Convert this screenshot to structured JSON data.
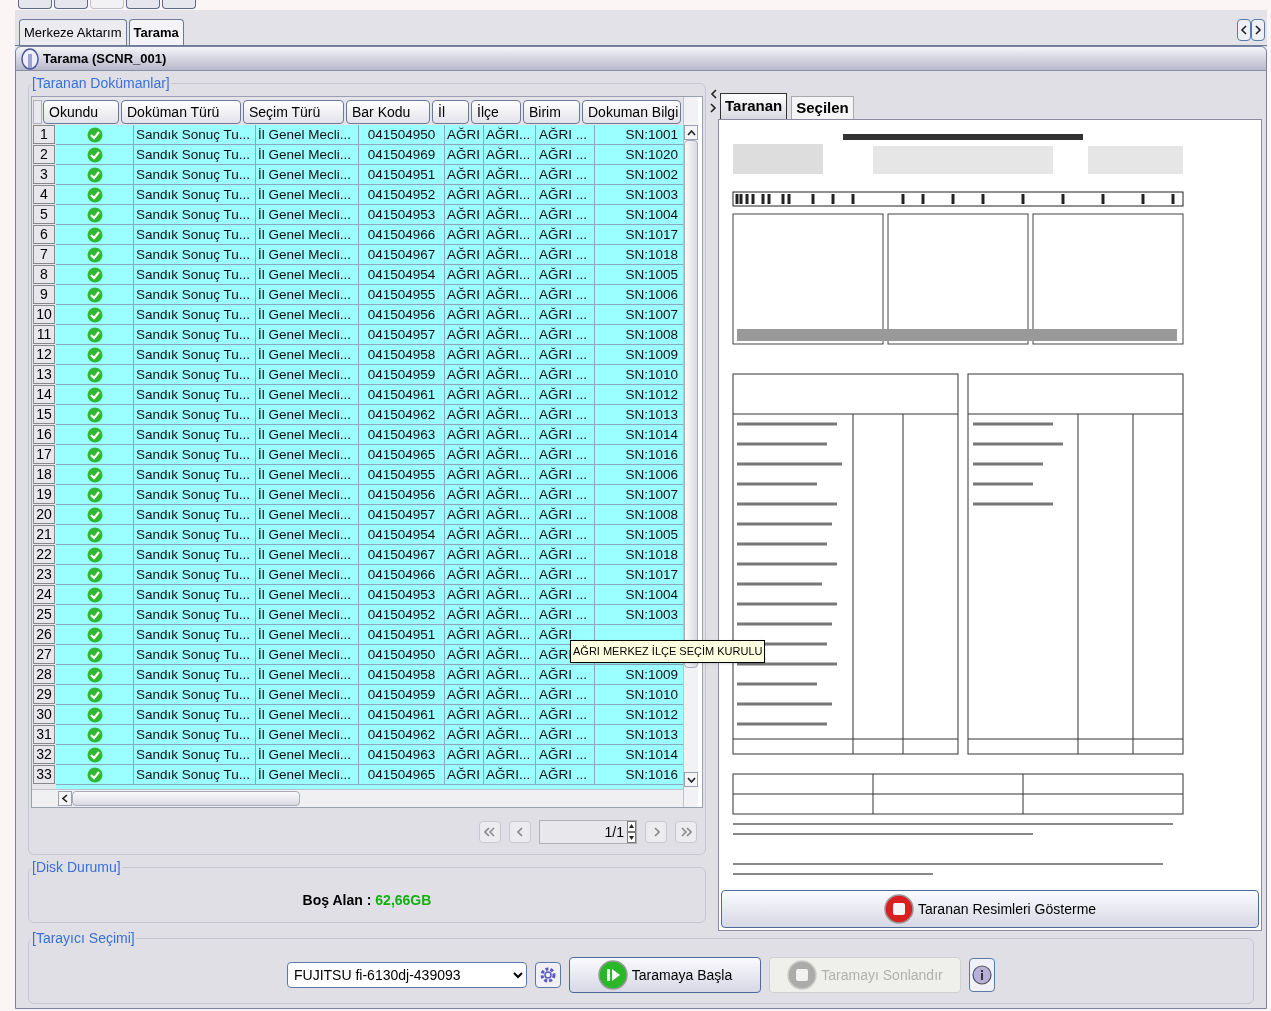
{
  "top_tabs": [
    {
      "label": "Merkeze Aktarım",
      "selected": false
    },
    {
      "label": "Tarama",
      "selected": true
    }
  ],
  "panel_title": "Tarama (SCNR_001)",
  "documents": {
    "legend": "[Taranan Dokümanlar]",
    "columns": [
      "Okundu",
      "Doküman Türü",
      "Seçim Türü",
      "Bar Kodu",
      "İl",
      "İlçe",
      "Birim",
      "Dokuman Bilgi"
    ],
    "rows": [
      {
        "number": "1",
        "read": true,
        "doc_type": "Sandık Sonuç Tu...",
        "election_type": "İl Genel Mecli...",
        "barcode": "041504950",
        "il": "AĞRI",
        "ilce": "AĞRI...",
        "birim": "AĞRI ...",
        "info": "SN:1001"
      },
      {
        "number": "2",
        "read": true,
        "doc_type": "Sandık Sonuç Tu...",
        "election_type": "İl Genel Mecli...",
        "barcode": "041504969",
        "il": "AĞRI",
        "ilce": "AĞRI...",
        "birim": "AĞRI ...",
        "info": "SN:1020"
      },
      {
        "number": "3",
        "read": true,
        "doc_type": "Sandık Sonuç Tu...",
        "election_type": "İl Genel Mecli...",
        "barcode": "041504951",
        "il": "AĞRI",
        "ilce": "AĞRI...",
        "birim": "AĞRI ...",
        "info": "SN:1002"
      },
      {
        "number": "4",
        "read": true,
        "doc_type": "Sandık Sonuç Tu...",
        "election_type": "İl Genel Mecli...",
        "barcode": "041504952",
        "il": "AĞRI",
        "ilce": "AĞRI...",
        "birim": "AĞRI ...",
        "info": "SN:1003"
      },
      {
        "number": "5",
        "read": true,
        "doc_type": "Sandık Sonuç Tu...",
        "election_type": "İl Genel Mecli...",
        "barcode": "041504953",
        "il": "AĞRI",
        "ilce": "AĞRI...",
        "birim": "AĞRI ...",
        "info": "SN:1004"
      },
      {
        "number": "6",
        "read": true,
        "doc_type": "Sandık Sonuç Tu...",
        "election_type": "İl Genel Mecli...",
        "barcode": "041504966",
        "il": "AĞRI",
        "ilce": "AĞRI...",
        "birim": "AĞRI ...",
        "info": "SN:1017"
      },
      {
        "number": "7",
        "read": true,
        "doc_type": "Sandık Sonuç Tu...",
        "election_type": "İl Genel Mecli...",
        "barcode": "041504967",
        "il": "AĞRI",
        "ilce": "AĞRI...",
        "birim": "AĞRI ...",
        "info": "SN:1018"
      },
      {
        "number": "8",
        "read": true,
        "doc_type": "Sandık Sonuç Tu...",
        "election_type": "İl Genel Mecli...",
        "barcode": "041504954",
        "il": "AĞRI",
        "ilce": "AĞRI...",
        "birim": "AĞRI ...",
        "info": "SN:1005"
      },
      {
        "number": "9",
        "read": true,
        "doc_type": "Sandık Sonuç Tu...",
        "election_type": "İl Genel Mecli...",
        "barcode": "041504955",
        "il": "AĞRI",
        "ilce": "AĞRI...",
        "birim": "AĞRI ...",
        "info": "SN:1006"
      },
      {
        "number": "10",
        "read": true,
        "doc_type": "Sandık Sonuç Tu...",
        "election_type": "İl Genel Mecli...",
        "barcode": "041504956",
        "il": "AĞRI",
        "ilce": "AĞRI...",
        "birim": "AĞRI ...",
        "info": "SN:1007"
      },
      {
        "number": "11",
        "read": true,
        "doc_type": "Sandık Sonuç Tu...",
        "election_type": "İl Genel Mecli...",
        "barcode": "041504957",
        "il": "AĞRI",
        "ilce": "AĞRI...",
        "birim": "AĞRI ...",
        "info": "SN:1008"
      },
      {
        "number": "12",
        "read": true,
        "doc_type": "Sandık Sonuç Tu...",
        "election_type": "İl Genel Mecli...",
        "barcode": "041504958",
        "il": "AĞRI",
        "ilce": "AĞRI...",
        "birim": "AĞRI ...",
        "info": "SN:1009"
      },
      {
        "number": "13",
        "read": true,
        "doc_type": "Sandık Sonuç Tu...",
        "election_type": "İl Genel Mecli...",
        "barcode": "041504959",
        "il": "AĞRI",
        "ilce": "AĞRI...",
        "birim": "AĞRI ...",
        "info": "SN:1010"
      },
      {
        "number": "14",
        "read": true,
        "doc_type": "Sandık Sonuç Tu...",
        "election_type": "İl Genel Mecli...",
        "barcode": "041504961",
        "il": "AĞRI",
        "ilce": "AĞRI...",
        "birim": "AĞRI ...",
        "info": "SN:1012"
      },
      {
        "number": "15",
        "read": true,
        "doc_type": "Sandık Sonuç Tu...",
        "election_type": "İl Genel Mecli...",
        "barcode": "041504962",
        "il": "AĞRI",
        "ilce": "AĞRI...",
        "birim": "AĞRI ...",
        "info": "SN:1013"
      },
      {
        "number": "16",
        "read": true,
        "doc_type": "Sandık Sonuç Tu...",
        "election_type": "İl Genel Mecli...",
        "barcode": "041504963",
        "il": "AĞRI",
        "ilce": "AĞRI...",
        "birim": "AĞRI ...",
        "info": "SN:1014"
      },
      {
        "number": "17",
        "read": true,
        "doc_type": "Sandık Sonuç Tu...",
        "election_type": "İl Genel Mecli...",
        "barcode": "041504965",
        "il": "AĞRI",
        "ilce": "AĞRI...",
        "birim": "AĞRI ...",
        "info": "SN:1016"
      },
      {
        "number": "18",
        "read": true,
        "doc_type": "Sandık Sonuç Tu...",
        "election_type": "İl Genel Mecli...",
        "barcode": "041504955",
        "il": "AĞRI",
        "ilce": "AĞRI...",
        "birim": "AĞRI ...",
        "info": "SN:1006"
      },
      {
        "number": "19",
        "read": true,
        "doc_type": "Sandık Sonuç Tu...",
        "election_type": "İl Genel Mecli...",
        "barcode": "041504956",
        "il": "AĞRI",
        "ilce": "AĞRI...",
        "birim": "AĞRI ...",
        "info": "SN:1007"
      },
      {
        "number": "20",
        "read": true,
        "doc_type": "Sandık Sonuç Tu...",
        "election_type": "İl Genel Mecli...",
        "barcode": "041504957",
        "il": "AĞRI",
        "ilce": "AĞRI...",
        "birim": "AĞRI ...",
        "info": "SN:1008"
      },
      {
        "number": "21",
        "read": true,
        "doc_type": "Sandık Sonuç Tu...",
        "election_type": "İl Genel Mecli...",
        "barcode": "041504954",
        "il": "AĞRI",
        "ilce": "AĞRI...",
        "birim": "AĞRI ...",
        "info": "SN:1005"
      },
      {
        "number": "22",
        "read": true,
        "doc_type": "Sandık Sonuç Tu...",
        "election_type": "İl Genel Mecli...",
        "barcode": "041504967",
        "il": "AĞRI",
        "ilce": "AĞRI...",
        "birim": "AĞRI ...",
        "info": "SN:1018"
      },
      {
        "number": "23",
        "read": true,
        "doc_type": "Sandık Sonuç Tu...",
        "election_type": "İl Genel Mecli...",
        "barcode": "041504966",
        "il": "AĞRI",
        "ilce": "AĞRI...",
        "birim": "AĞRI ...",
        "info": "SN:1017"
      },
      {
        "number": "24",
        "read": true,
        "doc_type": "Sandık Sonuç Tu...",
        "election_type": "İl Genel Mecli...",
        "barcode": "041504953",
        "il": "AĞRI",
        "ilce": "AĞRI...",
        "birim": "AĞRI ...",
        "info": "SN:1004"
      },
      {
        "number": "25",
        "read": true,
        "doc_type": "Sandık Sonuç Tu...",
        "election_type": "İl Genel Mecli...",
        "barcode": "041504952",
        "il": "AĞRI",
        "ilce": "AĞRI...",
        "birim": "AĞRI ...",
        "info": "SN:1003"
      },
      {
        "number": "26",
        "read": true,
        "doc_type": "Sandık Sonuç Tu...",
        "election_type": "İl Genel Mecli...",
        "barcode": "041504951",
        "il": "AĞRI",
        "ilce": "AĞRI...",
        "birim": "AĞRI"
      },
      {
        "number": "27",
        "read": true,
        "doc_type": "Sandık Sonuç Tu...",
        "election_type": "İl Genel Mecli...",
        "barcode": "041504950",
        "il": "AĞRI",
        "ilce": "AĞRI...",
        "birim": "AĞRI"
      },
      {
        "number": "28",
        "read": true,
        "doc_type": "Sandık Sonuç Tu...",
        "election_type": "İl Genel Mecli...",
        "barcode": "041504958",
        "il": "AĞRI",
        "ilce": "AĞRI...",
        "birim": "AĞRI ...",
        "info": "SN:1009"
      },
      {
        "number": "29",
        "read": true,
        "doc_type": "Sandık Sonuç Tu...",
        "election_type": "İl Genel Mecli...",
        "barcode": "041504959",
        "il": "AĞRI",
        "ilce": "AĞRI...",
        "birim": "AĞRI ...",
        "info": "SN:1010"
      },
      {
        "number": "30",
        "read": true,
        "doc_type": "Sandık Sonuç Tu...",
        "election_type": "İl Genel Mecli...",
        "barcode": "041504961",
        "il": "AĞRI",
        "ilce": "AĞRI...",
        "birim": "AĞRI ...",
        "info": "SN:1012"
      },
      {
        "number": "31",
        "read": true,
        "doc_type": "Sandık Sonuç Tu...",
        "election_type": "İl Genel Mecli...",
        "barcode": "041504962",
        "il": "AĞRI",
        "ilce": "AĞRI...",
        "birim": "AĞRI ...",
        "info": "SN:1013"
      },
      {
        "number": "32",
        "read": true,
        "doc_type": "Sandık Sonuç Tu...",
        "election_type": "İl Genel Mecli...",
        "barcode": "041504963",
        "il": "AĞRI",
        "ilce": "AĞRI...",
        "birim": "AĞRI ...",
        "info": "SN:1014"
      },
      {
        "number": "33",
        "read": true,
        "doc_type": "Sandık Sonuç Tu...",
        "election_type": "İl Genel Mecli...",
        "barcode": "041504965",
        "il": "AĞRI",
        "ilce": "AĞRI...",
        "birim": "AĞRI ...",
        "info": "SN:1016"
      }
    ],
    "page": "1/1",
    "tooltip": "AĞRI MERKEZ İLÇE SEÇİM KURULU"
  },
  "disk": {
    "legend": "[Disk Durumu]",
    "label": "Boş Alan :",
    "value": "62,66GB"
  },
  "viewer": {
    "tabs": [
      {
        "label": "Taranan",
        "selected": true
      },
      {
        "label": "Seçilen",
        "selected": false
      }
    ],
    "button": "Taranan Resimleri Gösterme"
  },
  "scanner": {
    "legend": "[Tarayıcı Seçimi]",
    "device": "FUJITSU fi-6130dj-439093",
    "buttons": [
      {
        "kind": "start",
        "label": "Taramaya Başla",
        "disabled": false
      },
      {
        "kind": "stop",
        "label": "Taramayı Sonlandır",
        "disabled": true
      }
    ]
  }
}
